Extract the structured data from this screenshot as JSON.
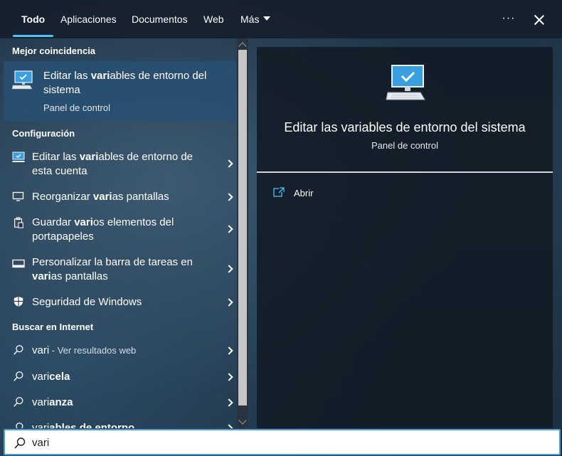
{
  "tabs": [
    {
      "label": "Todo",
      "active": true
    },
    {
      "label": "Aplicaciones",
      "active": false
    },
    {
      "label": "Documentos",
      "active": false
    },
    {
      "label": "Web",
      "active": false
    },
    {
      "label": "Más",
      "active": false
    }
  ],
  "toolbar": {
    "more_label": "···",
    "more_icon": "ellipsis-icon",
    "close_icon": "close-icon"
  },
  "best_match": {
    "header": "Mejor coincidencia",
    "title_pre": "Editar las ",
    "title_bold": "vari",
    "title_post": "ables de entorno del sistema",
    "subtitle": "Panel de control",
    "icon": "monitor-check-icon"
  },
  "settings": {
    "header": "Configuración",
    "items": [
      {
        "pre": "Editar las ",
        "bold": "vari",
        "post": "ables de entorno de esta cuenta",
        "icon": "monitor-check-icon"
      },
      {
        "pre": "Reorganizar ",
        "bold": "vari",
        "post": "as pantallas",
        "icon": "monitor-icon"
      },
      {
        "pre": "Guardar ",
        "bold": "vari",
        "post": "os elementos del portapapeles",
        "icon": "clipboard-icon"
      },
      {
        "pre": "Personalizar la barra de tareas en ",
        "bold": "vari",
        "post": "as pantallas",
        "icon": "taskbar-icon"
      },
      {
        "pre": "Seguridad de Windows",
        "bold": "",
        "post": "",
        "icon": "shield-icon"
      }
    ]
  },
  "web": {
    "header": "Buscar en Internet",
    "items": [
      {
        "main": "vari",
        "suffix": " - Ver resultados web",
        "icon": "search-icon"
      },
      {
        "pre": "vari",
        "bold": "cela",
        "icon": "search-icon"
      },
      {
        "pre": "vari",
        "bold": "anza",
        "icon": "search-icon"
      },
      {
        "pre": "vari",
        "bold": "ables de entorno",
        "icon": "search-icon"
      }
    ]
  },
  "preview": {
    "title": "Editar las variables de entorno del sistema",
    "subtitle": "Panel de control",
    "action_label": "Abrir",
    "action_icon": "open-external-icon"
  },
  "search": {
    "value": "vari",
    "placeholder": ""
  },
  "colors": {
    "accent": "#4cc2ff",
    "selected_bg": "#28506f",
    "searchbar_border": "#4c9fdc"
  }
}
